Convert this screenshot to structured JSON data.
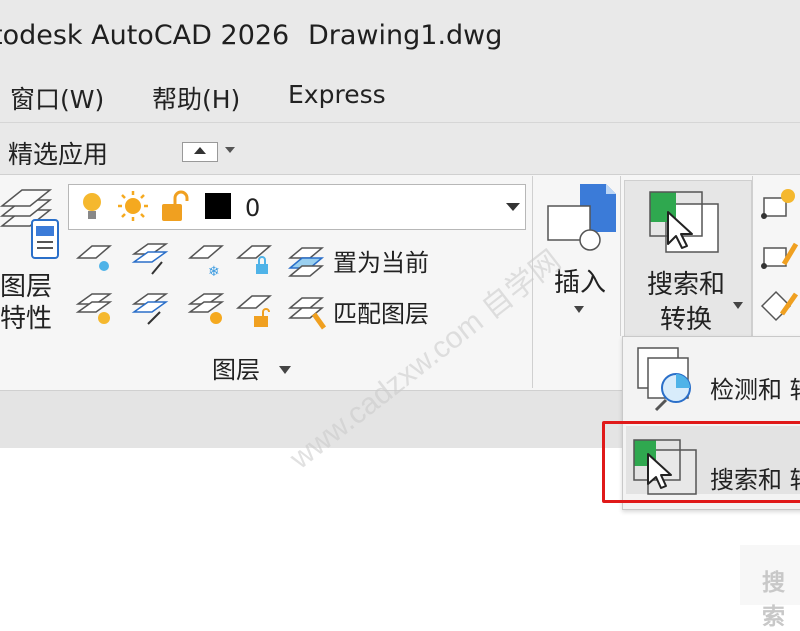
{
  "window": {
    "app_title": "todesk AutoCAD 2026",
    "file_name": "Drawing1.dwg"
  },
  "menu": {
    "items": [
      "窗口(W)",
      "帮助(H)",
      "Express"
    ]
  },
  "tabs": {
    "featured": "精选应用"
  },
  "layers_panel": {
    "big_button_line1": "图层",
    "big_button_line2": "特性",
    "current_layer": "0",
    "set_current_label": "置为当前",
    "match_layer_label": "匹配图层",
    "panel_title": "图层"
  },
  "block_panel": {
    "insert_label": "插入"
  },
  "search_panel": {
    "label_line1": "搜索和",
    "label_line2": "转换"
  },
  "dropdown": {
    "item1": "检测和 转",
    "item2": "搜索和 转"
  },
  "tooltip": {
    "text": "搜索"
  },
  "watermark": {
    "text": "www.cadzxw.com 自学网"
  },
  "colors": {
    "bulb_yellow": "#f5b82e",
    "lock_orange": "#f0a020",
    "accent_green": "#2fa84f",
    "highlight_red": "#e01919"
  }
}
